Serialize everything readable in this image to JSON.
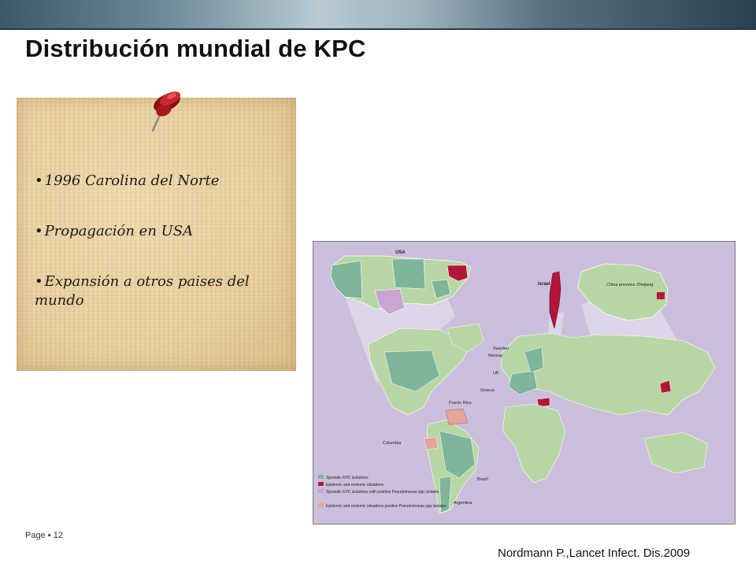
{
  "slide": {
    "title": "Distribución mundial de KPC",
    "page_label": "Page",
    "page_number": "12",
    "citation": "Nordmann P.,Lancet Infect. Dis.2009"
  },
  "note": {
    "bullets": [
      "1996 Carolina del Norte",
      "Propagación en USA",
      "Expansión a otros paises del mundo"
    ]
  },
  "map": {
    "region_labels": {
      "usa": "USA",
      "israel": "Israel",
      "china": "China province Zhejiang",
      "sweden": "Sweden",
      "norway": "Norway",
      "uk": "UK",
      "greece": "Greece",
      "puerto_rico": "Puerto Rico",
      "columbia": "Columbia",
      "brazil": "Brazil",
      "argentina": "Argentina"
    },
    "legend": [
      "Sporadic KPC isolations",
      "Epidemic and endemic situations",
      "Sporadic KPC isolations with positive Pseudomonas spp isolates",
      "Epidemic and endemic situations positive Pseudomonas spp isolates"
    ],
    "colors": {
      "background": "#cbbfdc",
      "land": "#b9d7a4",
      "sporadic": "#7fb59a",
      "epidemic": "#b3163a",
      "sporadic_pseudomonas": "#c8a6cf",
      "epidemic_pseudomonas": "#e6a49a"
    }
  }
}
